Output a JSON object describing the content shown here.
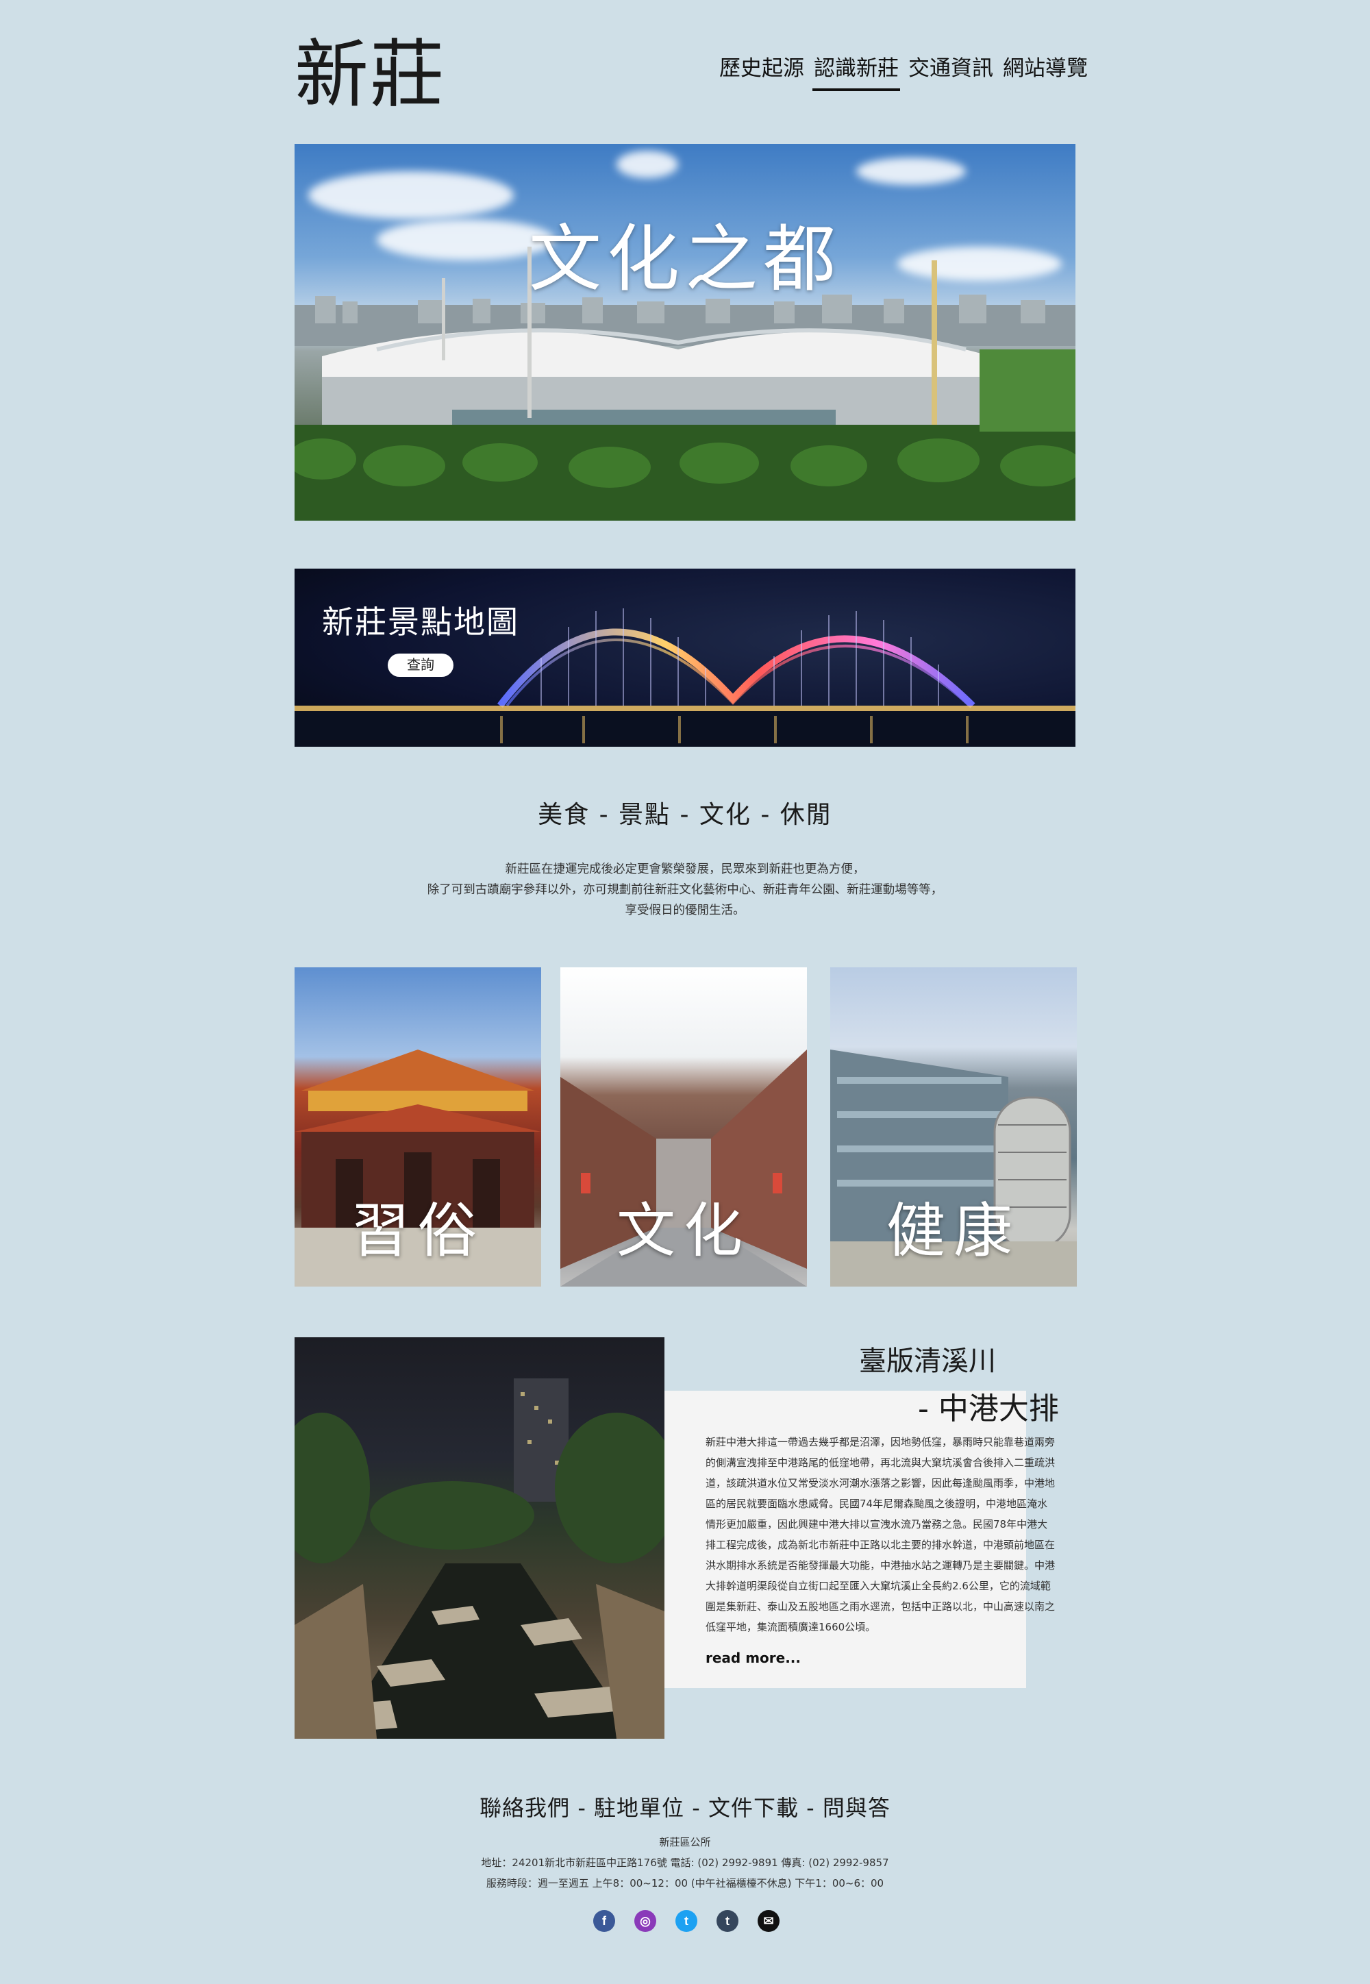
{
  "header": {
    "site_title": "新莊",
    "nav": [
      {
        "label": "歷史起源"
      },
      {
        "label": "認識新莊"
      },
      {
        "label": "交通資訊"
      },
      {
        "label": "網站導覽"
      }
    ],
    "active_nav_index": 1
  },
  "hero": {
    "title": "文化之都"
  },
  "map_banner": {
    "title": "新莊景點地圖",
    "button_label": "查詢"
  },
  "categories": {
    "heading": "美食 - 景點 - 文化 - 休閒",
    "intro_lines": [
      "新莊區在捷運完成後必定更會繁榮發展，民眾來到新莊也更為方便，",
      "除了可到古蹟廟宇參拜以外，亦可規劃前往新莊文化藝術中心、新莊青年公園、新莊運動場等等，",
      "享受假日的優閒生活。"
    ]
  },
  "tiles": [
    {
      "label": "習俗"
    },
    {
      "label": "文化"
    },
    {
      "label": "健康"
    }
  ],
  "feature": {
    "title_line1": "臺版清溪川",
    "title_line2": "- 中港大排",
    "body_lines": [
      "新莊中港大排這一帶過去幾乎都是沼澤，因地勢低窪，暴雨時只能靠巷道兩旁",
      "的側溝宣洩排至中港路尾的低窪地帶，再北流與大窠坑溪會合後排入二重疏洪",
      "道，該疏洪道水位又常受淡水河潮水漲落之影響，因此每逢颱風雨季，中港地",
      "區的居民就要面臨水患威脅。民國74年尼爾森颱風之後證明，中港地區淹水",
      "情形更加嚴重，因此興建中港大排以宣洩水流乃當務之急。民國78年中港大",
      "排工程完成後，成為新北市新莊中正路以北主要的排水幹道，中港頭前地區在",
      "洪水期排水系統是否能發揮最大功能，中港抽水站之運轉乃是主要關鍵。中港",
      "大排幹道明渠段從自立街口起至匯入大窠坑溪止全長約2.6公里，它的流域範",
      "圍是集新莊、泰山及五股地區之雨水逕流，包括中正路以北，中山高速以南之",
      "低窪平地，集流面積廣達1660公頃。"
    ],
    "read_more": "read more..."
  },
  "footer": {
    "links": [
      "聯絡我們",
      "駐地單位",
      "文件下載",
      "問與答"
    ],
    "org": "新莊區公所",
    "address": "地址：24201新北市新莊區中正路176號 電話: (02) 2992-9891 傳真: (02) 2992-9857",
    "hours": "服務時段：週一至週五 上午8：00~12：00 (中午社福櫃檯不休息) 下午1：00~6：00",
    "social": [
      {
        "icon": "facebook-icon",
        "glyph": "f",
        "color": "#3b5998"
      },
      {
        "icon": "instagram-icon",
        "glyph": "◎",
        "color": "#8a3ab9"
      },
      {
        "icon": "twitter-icon",
        "glyph": "t",
        "color": "#1da1f2"
      },
      {
        "icon": "tumblr-icon",
        "glyph": "t",
        "color": "#35465c"
      },
      {
        "icon": "mail-icon",
        "glyph": "✉",
        "color": "#111111"
      }
    ]
  }
}
